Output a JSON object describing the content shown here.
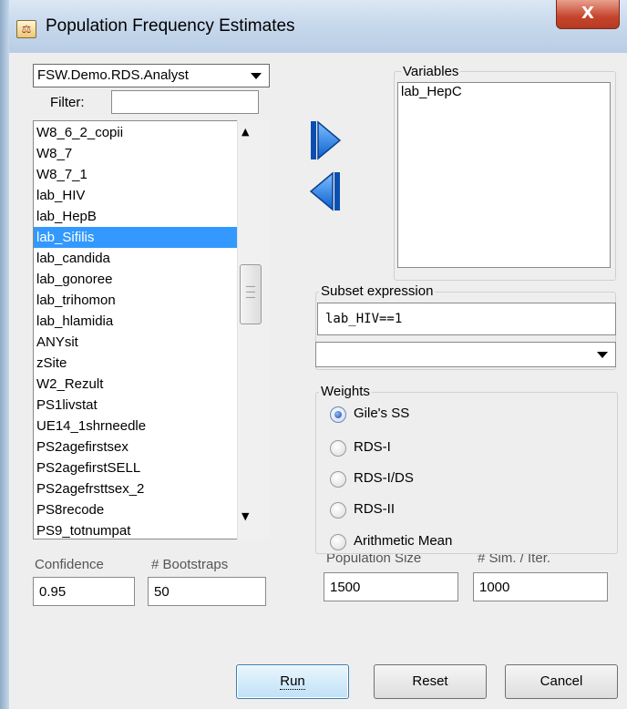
{
  "window": {
    "title": "Population Frequency Estimates",
    "close_label": "X",
    "app_icon_glyph": "⚖"
  },
  "dataset": {
    "selected": "FSW.Demo.RDS.Analyst"
  },
  "filter": {
    "label": "Filter:",
    "value": ""
  },
  "variable_list": {
    "items": [
      "W8_6_2_copii",
      "W8_7",
      "W8_7_1",
      "lab_HIV",
      "lab_HepB",
      "lab_Sifilis",
      "lab_candida",
      "lab_gonoree",
      "lab_trihomon",
      "lab_hlamidia",
      "ANYsit",
      "zSite",
      "W2_Rezult",
      "PS1livstat",
      "UE14_1shrneedle",
      "PS2agefirstsex",
      "PS2agefirstSELL",
      "PS2agefrsttsex_2",
      "PS8recode",
      "PS9_totnumpat"
    ],
    "selected_index": 5
  },
  "variables": {
    "title": "Variables",
    "items": [
      "lab_HepC"
    ]
  },
  "subset": {
    "title": "Subset expression",
    "value": "lab_HIV==1",
    "combo_value": ""
  },
  "weights": {
    "title": "Weights",
    "options": [
      "Gile's SS",
      "RDS-I",
      "RDS-I/DS",
      "RDS-II",
      "Arithmetic Mean"
    ],
    "selected_index": 0
  },
  "fields": {
    "confidence_label": "Confidence",
    "confidence_value": "0.95",
    "bootstraps_label": "# Bootstraps",
    "bootstraps_value": "50",
    "population_size_label": "Population Size",
    "population_size_value": "1500",
    "sim_iter_label": "# Sim. / Iter.",
    "sim_iter_value": "1000"
  },
  "buttons": {
    "run": "Run",
    "reset": "Reset",
    "cancel": "Cancel"
  },
  "colors": {
    "selection": "#3399ff",
    "arrow_blue": "#1a6fd6"
  }
}
